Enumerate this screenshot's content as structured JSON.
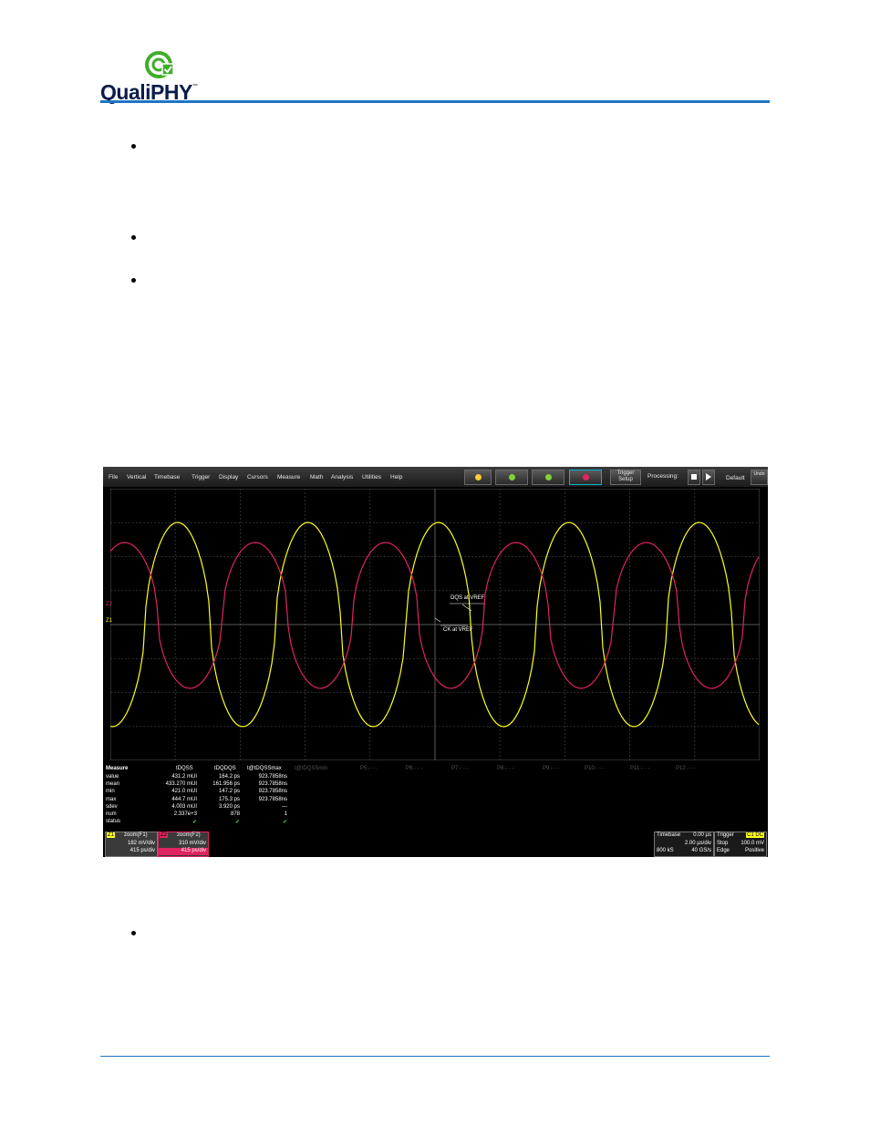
{
  "header": {
    "logo_text": "QualiPHY",
    "logo_tm": "™",
    "brand_colors": {
      "rule": "#1f75c2",
      "logo_green": "#3fae2a",
      "logo_dark": "#0b1c4a"
    }
  },
  "scope": {
    "menu": [
      "File",
      "Vertical",
      "Timebase",
      "Trigger",
      "Display",
      "Cursors",
      "Measure",
      "Math",
      "Analysis",
      "Utilities",
      "Help"
    ],
    "trigger_setup_label_1": "Trigger",
    "trigger_setup_label_2": "Setup",
    "processing_label": "Processing:",
    "default_label": "Default",
    "undo_label": "Undo",
    "trace_colors": {
      "ch1": "#ffff1a",
      "ch2": "#e0245e"
    },
    "annotations": {
      "dqs": "DQS at VREF",
      "ck": "CK at VREF"
    },
    "channel_markers": {
      "z1": "Z1",
      "z2": "Z2"
    },
    "measure_table": {
      "header": [
        "Measure",
        "tDQSS",
        "tDQDQS",
        "t@tDQSSmax",
        "t@tDQSSmin",
        "P5:- - -",
        "P6:- - -",
        "P7:- - -",
        "P8:- - -",
        "P9:- - -",
        "P10:- - -",
        "P11:- - -",
        "P12:- - -"
      ],
      "rows": [
        {
          "label": "value",
          "c1": "431.2 mUI",
          "c2": "164.2 ps",
          "c3": "923.7858ns"
        },
        {
          "label": "mean",
          "c1": "433.270 mUI",
          "c2": "161.956 ps",
          "c3": "923.7858ns"
        },
        {
          "label": "min",
          "c1": "421.0 mUI",
          "c2": "147.2 ps",
          "c3": "923.7858ns"
        },
        {
          "label": "max",
          "c1": "444.7 mUI",
          "c2": "175.3 ps",
          "c3": "923.7858ns"
        },
        {
          "label": "sdev",
          "c1": "4.003 mUI",
          "c2": "3.920 ps",
          "c3": "---"
        },
        {
          "label": "num",
          "c1": "2.337e+3",
          "c2": "878",
          "c3": "1"
        },
        {
          "label": "status",
          "c1": "✔",
          "c2": "✔",
          "c3": "✔"
        }
      ]
    },
    "zoom1": {
      "tag": "Z1",
      "name": "zoom(F1)",
      "vdiv": "182 mV/div",
      "tdiv": "415 ps/div"
    },
    "zoom2": {
      "tag": "Z2",
      "name": "zoom(F2)",
      "vdiv": "310 mV/div",
      "tdiv": "415 ps/div"
    },
    "timebase": {
      "label": "Timebase",
      "delay": "0.00 µs",
      "tdiv": "2.00 µs/div",
      "samples": "800 kS",
      "rate": "40 GS/s"
    },
    "trigger": {
      "label": "Trigger",
      "source": "C1 DC",
      "mode": "Stop",
      "level": "100.0 mV",
      "type": "Edge",
      "slope": "Positive"
    }
  }
}
